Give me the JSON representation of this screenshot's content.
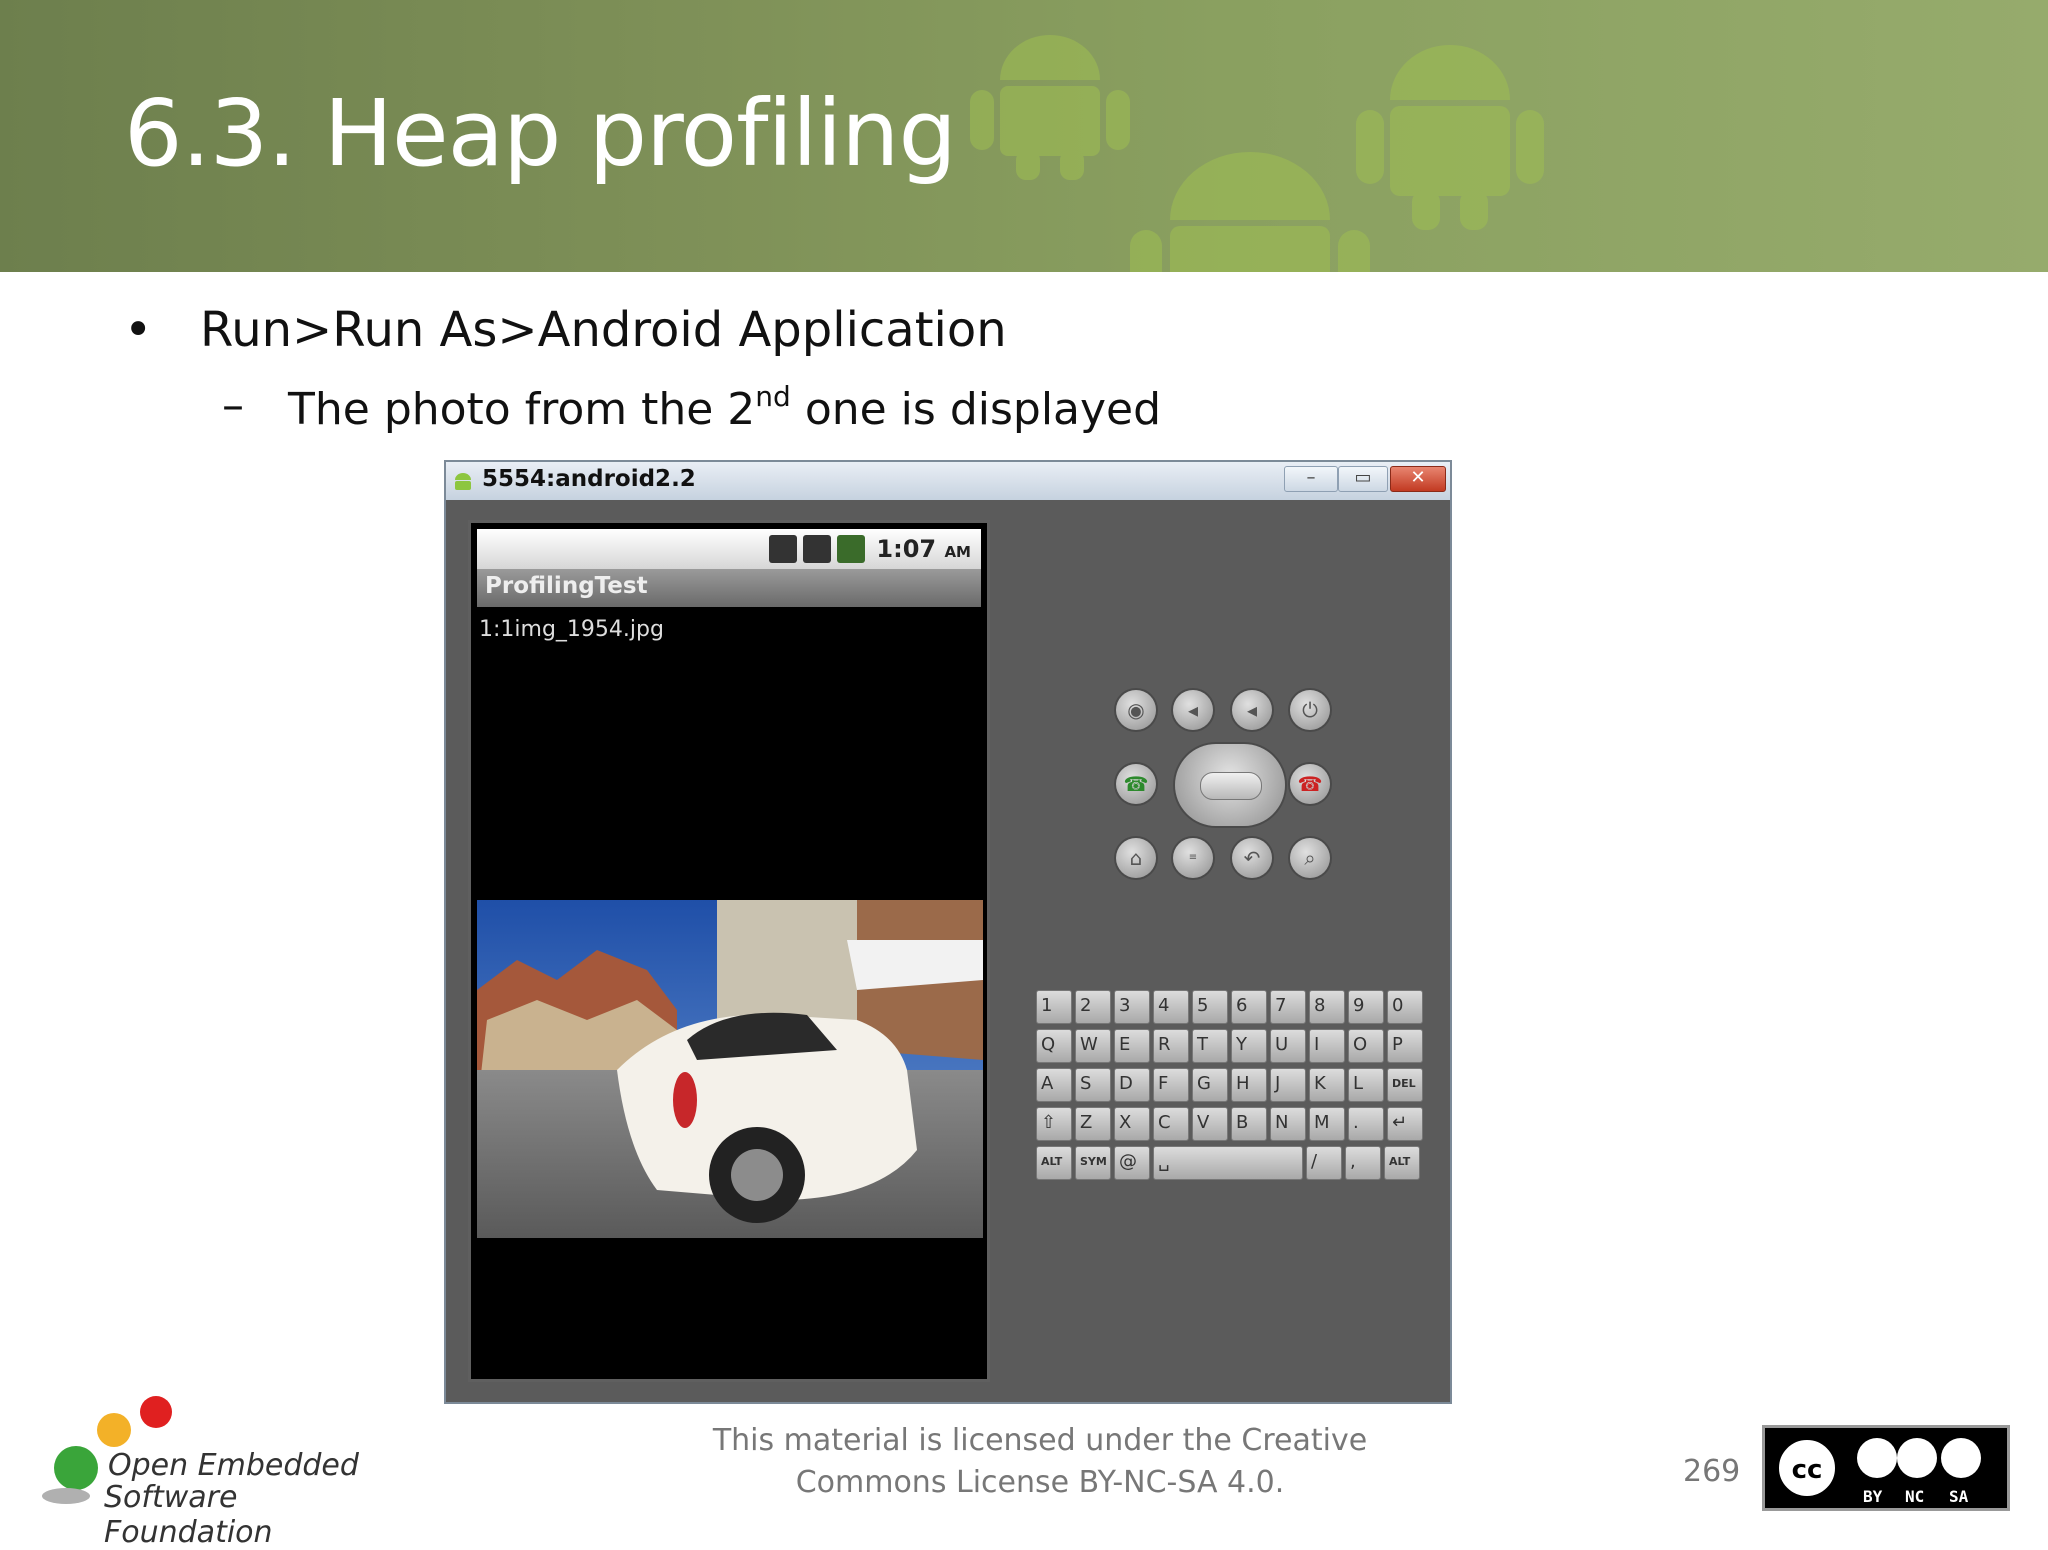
{
  "slide": {
    "title": "6.3. Heap profiling",
    "bullet1": "Run>Run As>Android Application",
    "bullet2_pre": "The photo from the 2",
    "bullet2_sup": "nd",
    "bullet2_post": " one is displayed",
    "bullet_marker": "•",
    "dash_marker": "–"
  },
  "emulator": {
    "window_title": "5554:android2.2",
    "minimize": "–",
    "maximize": "▭",
    "close": "✕",
    "status_time": "1:07",
    "status_ampm": "AM",
    "app_name": "ProfilingTest",
    "file_label": "1:1img_1954.jpg"
  },
  "keyboard": {
    "row1": [
      "1",
      "2",
      "3",
      "4",
      "5",
      "6",
      "7",
      "8",
      "9",
      "0"
    ],
    "row2": [
      "Q",
      "W",
      "E",
      "R",
      "T",
      "Y",
      "U",
      "I",
      "O",
      "P"
    ],
    "row3": [
      "A",
      "S",
      "D",
      "F",
      "G",
      "H",
      "J",
      "K",
      "L",
      "DEL"
    ],
    "row4": [
      "⇧",
      "Z",
      "X",
      "C",
      "V",
      "B",
      "N",
      "M",
      ".",
      "↵"
    ],
    "row5": [
      "ALT",
      "SYM",
      "@",
      "␣",
      "/",
      ",",
      "ALT"
    ]
  },
  "footer": {
    "logo_line1": "Open Embedded",
    "logo_line2": "Software Foundation",
    "license_line1": "This material is licensed under the Creative",
    "license_line2": "Commons License BY-NC-SA 4.0.",
    "page_number": "269",
    "cc_by": "BY",
    "cc_nc": "NC",
    "cc_sa": "SA"
  },
  "colors": {
    "header_green": "#7f9158",
    "emulator_body": "#5b5b5b",
    "close_red": "#c23a22"
  }
}
